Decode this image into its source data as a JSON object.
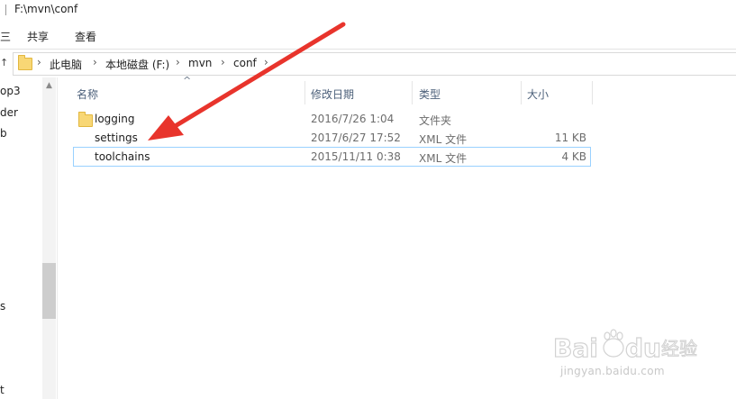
{
  "window": {
    "path_title": "F:\\mvn\\conf"
  },
  "ribbon": {
    "tabs": [
      "共享",
      "查看"
    ]
  },
  "address": {
    "crumbs": [
      "此电脑",
      "本地磁盘 (F:)",
      "mvn",
      "conf"
    ]
  },
  "nav": {
    "items": [
      "op3",
      "der",
      "b",
      "s",
      "t"
    ]
  },
  "columns": {
    "name": "名称",
    "modified": "修改日期",
    "type": "类型",
    "size": "大小"
  },
  "files": [
    {
      "name": "logging",
      "modified": "2016/7/26 1:04",
      "type": "文件夹",
      "size": "",
      "icon": "folder-icon"
    },
    {
      "name": "settings",
      "modified": "2017/6/27 17:52",
      "type": "XML 文件",
      "size": "11 KB",
      "icon": "none"
    },
    {
      "name": "toolchains",
      "modified": "2015/11/11 0:38",
      "type": "XML 文件",
      "size": "4 KB",
      "icon": "none"
    }
  ],
  "watermark": {
    "logo": "Baidu 经验",
    "url": "jingyan.baidu.com"
  },
  "colors": {
    "annotation_arrow": "#e8342c",
    "selection_border": "#99d1ff",
    "folder": "#f8d775"
  }
}
